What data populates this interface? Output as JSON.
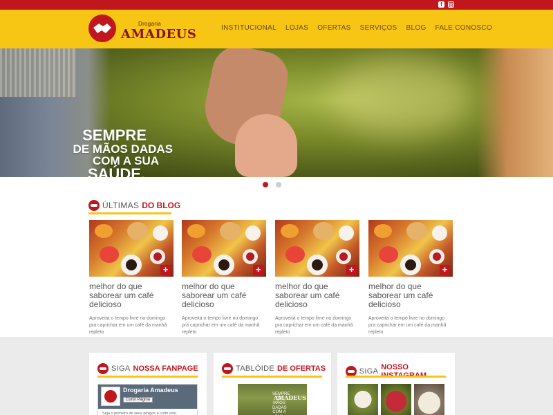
{
  "social": {
    "facebook_icon": "f",
    "instagram_icon": "◎"
  },
  "logo": {
    "small": "Drogaria",
    "big": "AMADEUS"
  },
  "nav": [
    "Institucional",
    "Lojas",
    "Ofertas",
    "Serviços",
    "Blog",
    "Fale Conosco"
  ],
  "hero": {
    "line1": "Sempre",
    "line2": "de mãos dadas",
    "line3": "com a sua",
    "line4": "saúde."
  },
  "slider_dots": {
    "count": 2,
    "active": 0
  },
  "blog": {
    "title_normal": "Últimas",
    "title_bold": "do blog",
    "posts": [
      {
        "title": "melhor do que saborear um café delicioso",
        "excerpt": "Aproveita o tempo livre no domingo pra caprichar em um café da manhã repleto"
      },
      {
        "title": "melhor do que saborear um café delicioso",
        "excerpt": "Aproveita o tempo livre no domingo pra caprichar em um café da manhã repleto"
      },
      {
        "title": "melhor do que saborear um café delicioso",
        "excerpt": "Aproveita o tempo livre no domingo pra caprichar em um café da manhã repleto"
      },
      {
        "title": "melhor do que saborear um café delicioso",
        "excerpt": "Aproveita o tempo livre no domingo pra caprichar em um café da manhã repleto"
      }
    ],
    "plus_label": "+"
  },
  "fanpage": {
    "title_normal": "Siga",
    "title_bold": "nossa fanpage",
    "page_name": "Drogaria Amadeus",
    "like_label": "Curtir Página",
    "footer_text": "Seja o primeiro de seus amigos a curtir isso."
  },
  "tabloide": {
    "title_normal": "Tablóide",
    "title_bold": "de ofertas",
    "image_caption": "SEMPRE DE MÃOS DADAS COM A SUA SAÚDE.",
    "image_logo": "AMADEUS"
  },
  "instagram": {
    "title_normal": "Siga",
    "title_bold": "nosso instagram"
  },
  "colors": {
    "red": "#c0161d",
    "yellow": "#f7c513",
    "gray": "#ebebeb"
  }
}
